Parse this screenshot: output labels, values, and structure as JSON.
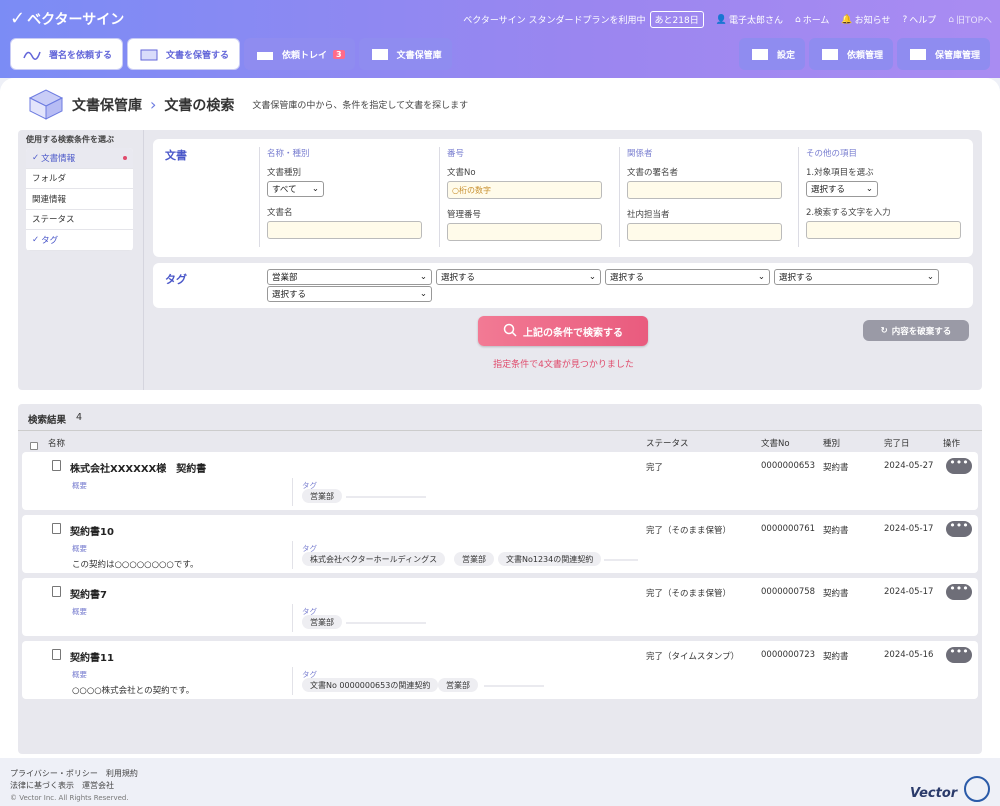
{
  "app": {
    "name": "ベクターサイン"
  },
  "topnav": {
    "plan_text": "ベクターサイン スタンダードプランを利用中",
    "plan_days": "あと218日",
    "user": "電子太郎さん",
    "home": "ホーム",
    "notice": "お知らせ",
    "help": "ヘルプ",
    "old_top": "旧TOPへ"
  },
  "actions": {
    "request_sign": "署名を依頼する",
    "store_doc": "文書を保管する",
    "request_tray": "依頼トレイ",
    "request_tray_count": "3",
    "storage": "文書保管庫",
    "settings": "設定",
    "request_mgmt": "依頼管理",
    "storage_mgmt": "保管庫管理"
  },
  "page": {
    "breadcrumb_parent": "文書保管庫",
    "title": "文書の検索",
    "description": "文書保管庫の中から、条件を指定して文書を探します"
  },
  "conditions": {
    "heading": "使用する検索条件を選ぶ",
    "items": [
      {
        "label": "文書情報",
        "checked": true
      },
      {
        "label": "フォルダ",
        "checked": false
      },
      {
        "label": "関連情報",
        "checked": false
      },
      {
        "label": "ステータス",
        "checked": false
      },
      {
        "label": "タグ",
        "checked": true
      }
    ]
  },
  "doc_form": {
    "section_label": "文書",
    "col1_head": "名称・種別",
    "doc_type_label": "文書種別",
    "doc_type_value": "すべて",
    "doc_name_label": "文書名",
    "col2_head": "番号",
    "doc_no_label": "文書No",
    "doc_no_placeholder": "○桁の数字",
    "mgmt_no_label": "管理番号",
    "col3_head": "関係者",
    "signer_label": "文書の署名者",
    "staff_label": "社内担当者",
    "col4_head": "その他の項目",
    "target_label": "1.対象項目を選ぶ",
    "target_value": "選択する",
    "keyword_label": "2.検索する文字を入力"
  },
  "tag_form": {
    "section_label": "タグ",
    "selects": [
      "営業部",
      "選択する",
      "選択する",
      "選択する",
      "選択する"
    ]
  },
  "search_button": "上記の条件で検索する",
  "clear_button": "内容を破棄する",
  "found_text": "指定条件で4文書が見つかりました",
  "results": {
    "heading": "検索結果",
    "count": "4",
    "columns": {
      "name": "名称",
      "status": "ステータス",
      "doc_no": "文書No",
      "type": "種別",
      "completed": "完了日",
      "ops": "操作"
    },
    "summary_label": "概要",
    "tag_label": "タグ",
    "rows": [
      {
        "title": "株式会社XXXXXX様　契約書",
        "summary": "",
        "tags": [
          "営業部"
        ],
        "status": "完了",
        "doc_no": "0000000653",
        "type": "契約書",
        "date": "2024-05-27"
      },
      {
        "title": "契約書10",
        "summary": "この契約は○○○○○○○○です。",
        "tags": [
          "株式会社ベクターホールディングス",
          "営業部",
          "文書No1234の関連契約"
        ],
        "status": "完了（そのまま保管）",
        "doc_no": "0000000761",
        "type": "契約書",
        "date": "2024-05-17"
      },
      {
        "title": "契約書7",
        "summary": "",
        "tags": [
          "営業部"
        ],
        "status": "完了（そのまま保管）",
        "doc_no": "0000000758",
        "type": "契約書",
        "date": "2024-05-17"
      },
      {
        "title": "契約書11",
        "summary": "○○○○株式会社との契約です。",
        "tags": [
          "文書No 0000000653の関連契約",
          "営業部"
        ],
        "status": "完了（タイムスタンプ）",
        "doc_no": "0000000723",
        "type": "契約書",
        "date": "2024-05-16"
      }
    ]
  },
  "footer": {
    "privacy": "プライバシー・ポリシー",
    "terms": "利用規約",
    "legal": "法律に基づく表示",
    "company": "運営会社",
    "copyright": "© Vector Inc. All Rights Reserved.",
    "brand": "Vector"
  }
}
